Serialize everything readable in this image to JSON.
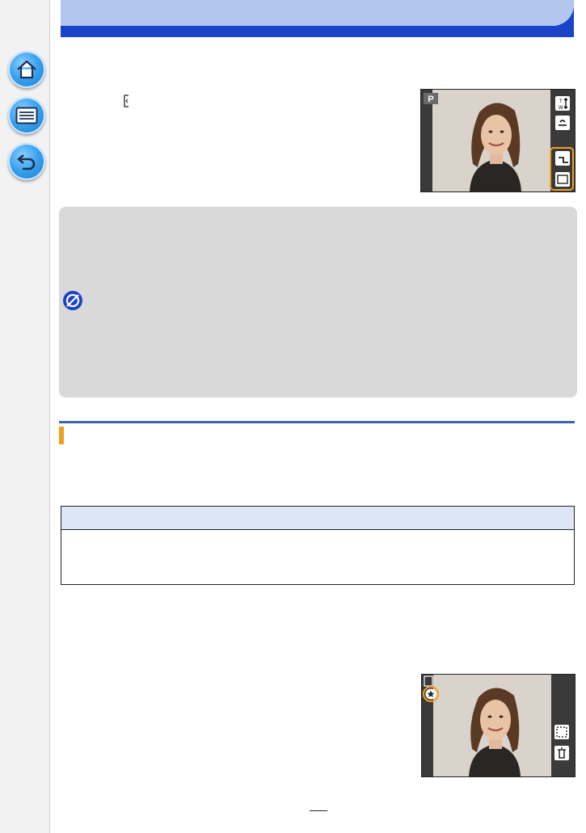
{
  "sidebar": {
    "home": "home-icon",
    "menu": "menu-list-icon",
    "back": "back-arrow-icon"
  },
  "header": {
    "fill_color": "#b3c6ee",
    "accent_color": "#1a44c8"
  },
  "thumbnails": {
    "top": {
      "mode_badge": "P",
      "zoom_label": "T W"
    },
    "bottom": {
      "mark": "star"
    }
  },
  "note": {
    "icon": "not-available-icon",
    "background": "#d9d9d9"
  },
  "section": {
    "rule_color": "#3c64b4",
    "marker_color": "#f0a020"
  },
  "table": {
    "header_fill": "#dce6f7"
  }
}
